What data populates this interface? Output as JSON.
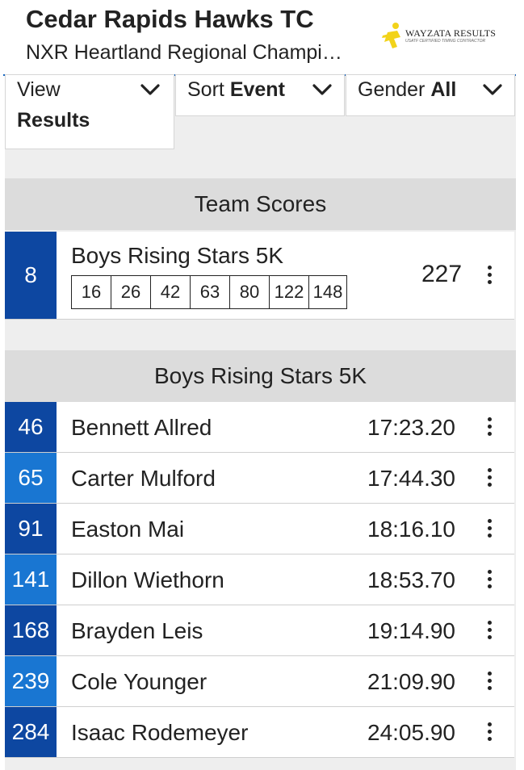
{
  "header": {
    "title": "Cedar Rapids Hawks TC",
    "subtitle": "NXR Heartland Regional Champi…",
    "logo_text": "WAYZATA RESULTS",
    "logo_tagline": "USATF CERTIFIED TIMING CONTRACTOR"
  },
  "filters": {
    "view": {
      "label": "View",
      "value": "Results"
    },
    "sort": {
      "label": "Sort",
      "value": "Event"
    },
    "gender": {
      "label": "Gender",
      "value": "All"
    }
  },
  "team_scores": {
    "heading": "Team Scores",
    "entry": {
      "place": "8",
      "event": "Boys Rising Stars 5K",
      "scorers": [
        "16",
        "26",
        "42",
        "63",
        "80",
        "122",
        "148"
      ],
      "total": "227"
    }
  },
  "results": {
    "heading": "Boys Rising Stars 5K",
    "rows": [
      {
        "place": "46",
        "name": "Bennett Allred",
        "time": "17:23.20"
      },
      {
        "place": "65",
        "name": "Carter Mulford",
        "time": "17:44.30"
      },
      {
        "place": "91",
        "name": "Easton Mai",
        "time": "18:16.10"
      },
      {
        "place": "141",
        "name": "Dillon Wiethorn",
        "time": "18:53.70"
      },
      {
        "place": "168",
        "name": "Brayden Leis",
        "time": "19:14.90"
      },
      {
        "place": "239",
        "name": "Cole Younger",
        "time": "21:09.90"
      },
      {
        "place": "284",
        "name": "Isaac Rodemeyer",
        "time": "24:05.90"
      }
    ]
  },
  "colors": {
    "accent": "#1565c0",
    "place_dark": "#0d47a1",
    "place_light": "#1976d2"
  },
  "icons": {
    "dropdown": "chevron-down-icon",
    "row_menu": "more-vertical-icon",
    "logo": "runner-icon"
  }
}
